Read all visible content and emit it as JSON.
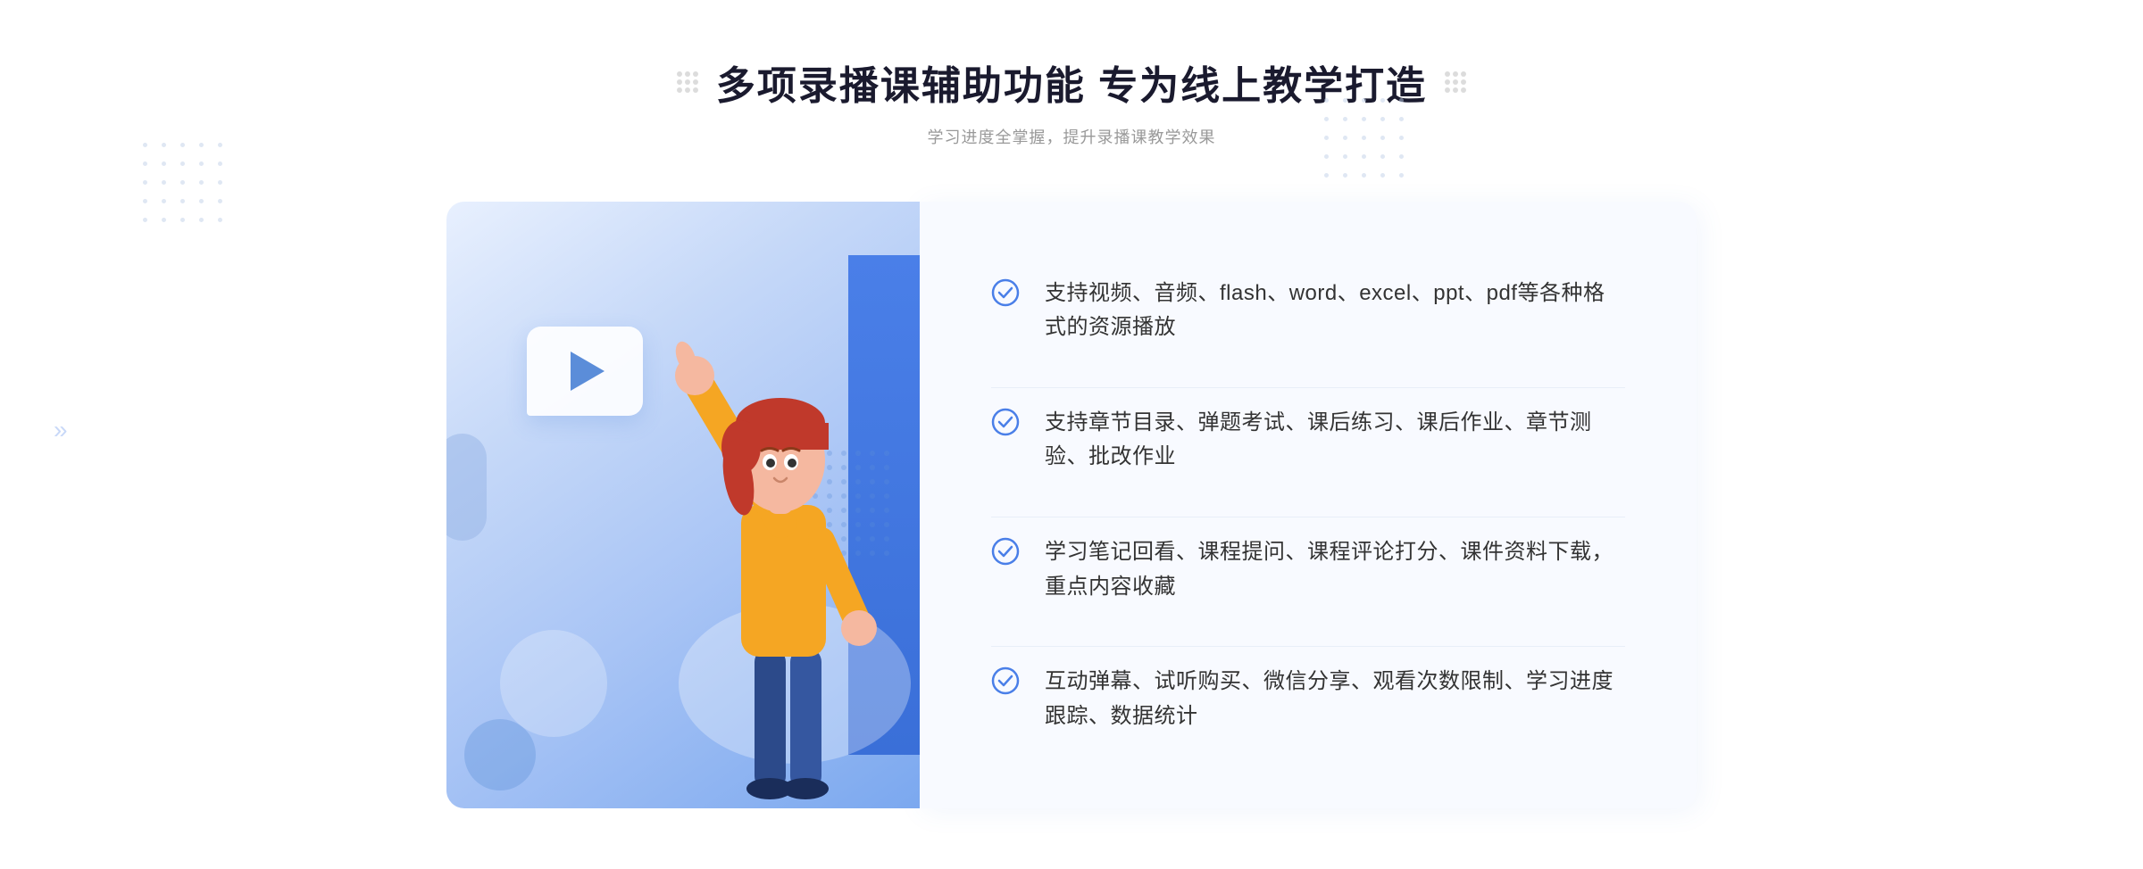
{
  "header": {
    "main_title": "多项录播课辅助功能 专为线上教学打造",
    "sub_title": "学习进度全掌握，提升录播课教学效果"
  },
  "features": [
    {
      "id": 1,
      "text": "支持视频、音频、flash、word、excel、ppt、pdf等各种格式的资源播放"
    },
    {
      "id": 2,
      "text": "支持章节目录、弹题考试、课后练习、课后作业、章节测验、批改作业"
    },
    {
      "id": 3,
      "text": "学习笔记回看、课程提问、课程评论打分、课件资料下载，重点内容收藏"
    },
    {
      "id": 4,
      "text": "互动弹幕、试听购买、微信分享、观看次数限制、学习进度跟踪、数据统计"
    }
  ],
  "colors": {
    "primary": "#4a7fe8",
    "primary_light": "#7ba8ef",
    "check_color": "#4a7fe8",
    "text_main": "#333333",
    "text_sub": "#999999"
  }
}
